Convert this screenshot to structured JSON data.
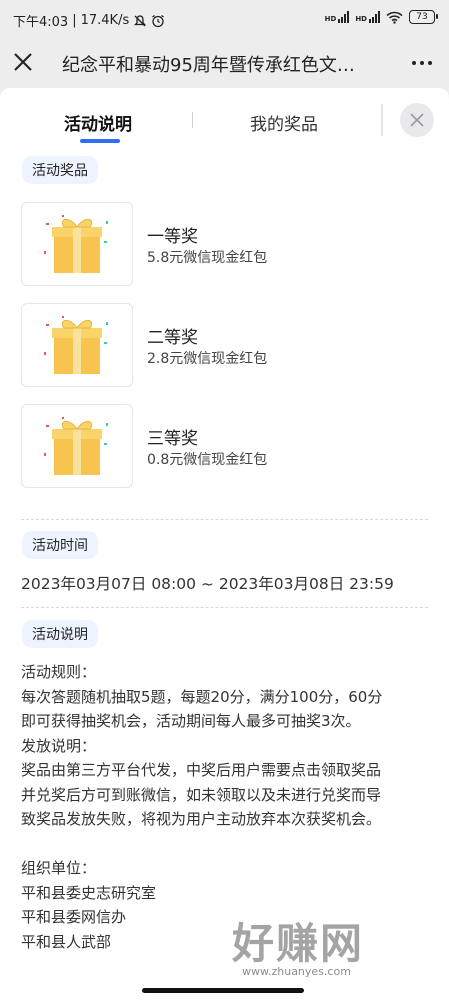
{
  "status_bar": {
    "time": "下午4:03",
    "separator": "|",
    "net_speed": "17.4K/s",
    "battery": "73",
    "hd_label": "HD"
  },
  "nav": {
    "title": "纪念平和暴动95周年暨传承红色文…"
  },
  "tabs": [
    {
      "label": "活动说明",
      "active": true
    },
    {
      "label": "我的奖品",
      "active": false
    }
  ],
  "prizes_section": {
    "title": "活动奖品",
    "items": [
      {
        "name": "一等奖",
        "desc": "5.8元微信现金红包"
      },
      {
        "name": "二等奖",
        "desc": "2.8元微信现金红包"
      },
      {
        "name": "三等奖",
        "desc": "0.8元微信现金红包"
      }
    ]
  },
  "time_section": {
    "title": "活动时间",
    "text": "2023年03月07日 08:00 ~ 2023年03月08日 23:59"
  },
  "desc_section": {
    "title": "活动说明",
    "lines": [
      "活动规则：",
      "每次答题随机抽取5题，每题20分，满分100分，60分",
      "即可获得抽奖机会，活动期间每人最多可抽奖3次。",
      "发放说明：",
      "奖品由第三方平台代发，中奖后用户需要点击领取奖品",
      "并兑奖后方可到账微信，如未领取以及未进行兑奖而导",
      "致奖品发放失败，将视为用户主动放弃本次获奖机会。",
      "",
      "组织单位：",
      "平和县委史志研究室",
      "平和县委网信办",
      "平和县人武部"
    ]
  },
  "watermark": {
    "text": "好赚网",
    "url": "www.zhuanyes.com"
  },
  "colors": {
    "accent": "#2f6ef5",
    "label_bg": "#eef4ff",
    "gift": "#f6c44f"
  }
}
